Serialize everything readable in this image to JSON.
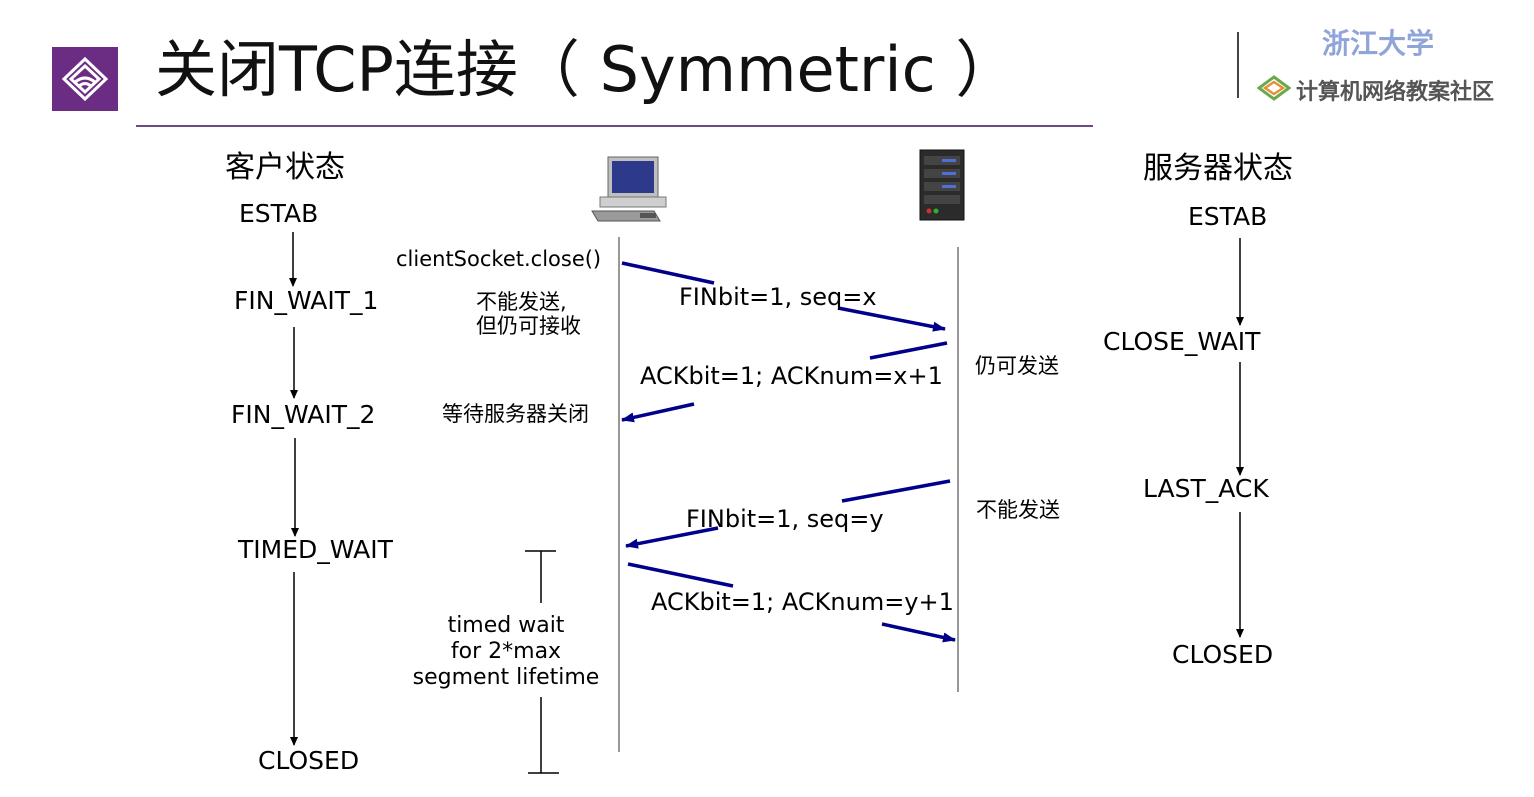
{
  "header": {
    "title": "关闭TCP连接（ Symmetric ）",
    "brand_university": "浙江大学",
    "brand_community": "计算机网络教案社区"
  },
  "client": {
    "heading": "客户状态",
    "states": [
      "ESTAB",
      "FIN_WAIT_1",
      "FIN_WAIT_2",
      "TIMED_WAIT",
      "CLOSED"
    ]
  },
  "server": {
    "heading": "服务器状态",
    "states": [
      "ESTAB",
      "CLOSE_WAIT",
      "LAST_ACK",
      "CLOSED"
    ]
  },
  "annotations": {
    "client_close_call": "clientSocket.close()",
    "cannot_send_line1": "不能发送,",
    "cannot_send_line2": "但仍可接收",
    "wait_server_close": "等待服务器关闭",
    "server_can_still_send": "仍可发送",
    "server_cannot_send": "不能发送",
    "timed_wait_line1": "timed wait",
    "timed_wait_line2": "for 2*max",
    "timed_wait_line3": "segment lifetime"
  },
  "messages": {
    "fin_client": "FINbit=1, seq=x",
    "ack_server": "ACKbit=1; ACKnum=x+1",
    "fin_server": "FINbit=1, seq=y",
    "ack_client": "ACKbit=1; ACKnum=y+1"
  },
  "icons": {
    "logo": "zju-logo-icon",
    "brand_mark": "diamond-brand-icon",
    "client_host": "desktop-computer-icon",
    "server_host": "server-rack-icon"
  },
  "colors": {
    "accent_purple": "#6b2d83",
    "arrow_blue": "#00008b",
    "brand_blue": "#8fa4d8"
  }
}
